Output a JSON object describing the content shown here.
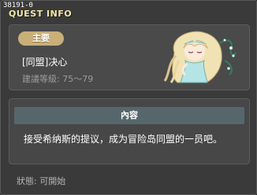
{
  "window": {
    "quest_id": "38191-0",
    "title": "QUEST INFO"
  },
  "quest": {
    "category_badge": "主要",
    "name": "[同盟]决心",
    "level_requirement": "建議等級: 75～79",
    "npc_icon": "npc-portrait-icon"
  },
  "content": {
    "header": "內容",
    "text": "接受希纳斯的提议，成为冒险岛同盟的一员吧。"
  },
  "status": {
    "text": "狀態: 可開始"
  },
  "colors": {
    "title": "#f4e8a8",
    "badge": "#c9b079",
    "content_header": "#56676b",
    "window_bg": "#3a3a3a"
  }
}
